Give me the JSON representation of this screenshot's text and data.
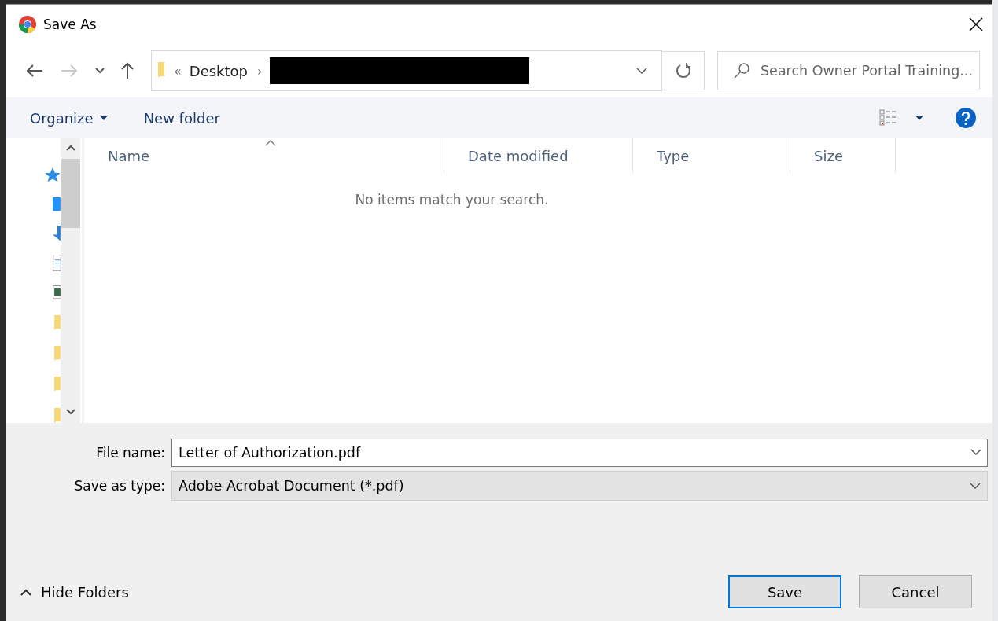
{
  "window": {
    "title": "Save As"
  },
  "navigation": [
    {
      "kind": "back",
      "disabled": false
    },
    {
      "kind": "forward",
      "disabled": true
    },
    {
      "kind": "recent",
      "disabled": false
    },
    {
      "kind": "up",
      "disabled": false
    }
  ],
  "address_bar": {
    "overflow": "«",
    "location": "Desktop",
    "separator": "›",
    "redacted": true
  },
  "search": {
    "placeholder": "Search Owner Portal Training..."
  },
  "toolbar": {
    "organize": "Organize",
    "new_folder": "New folder"
  },
  "table": {
    "columns": [
      {
        "label": "Name",
        "sorted": true
      },
      {
        "label": "Date modified",
        "sorted": false
      },
      {
        "label": "Type",
        "sorted": false
      },
      {
        "label": "Size",
        "sorted": false
      }
    ],
    "empty_message": "No items match your search."
  },
  "fields": [
    {
      "label": "File name:",
      "value": "Letter of Authorization.pdf",
      "kind": "editable"
    },
    {
      "label": "Save as type:",
      "value": "Adobe Acrobat Document (*.pdf)",
      "kind": "dropdown"
    }
  ],
  "hide_folders": "Hide Folders",
  "buttons": [
    {
      "label": "Save",
      "default": true
    },
    {
      "label": "Cancel",
      "default": false
    }
  ]
}
